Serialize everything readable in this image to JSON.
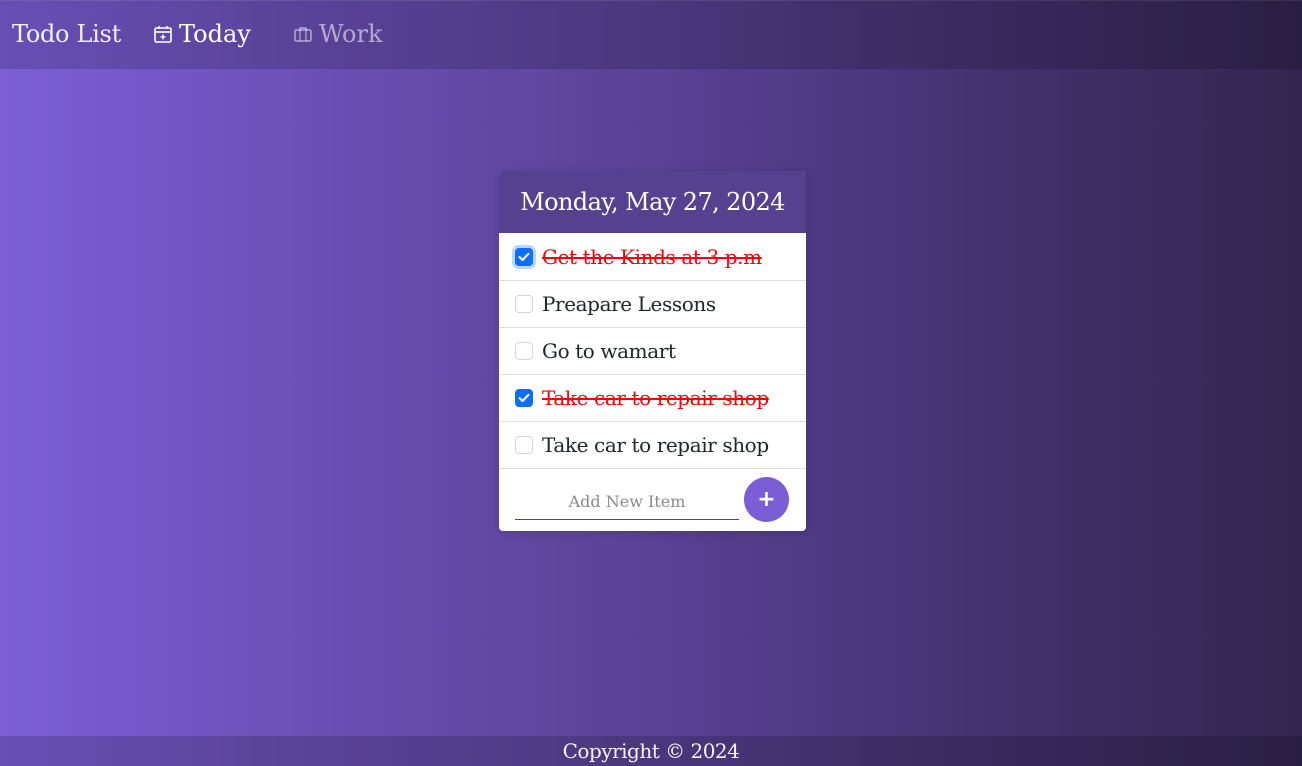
{
  "navbar": {
    "brand": "Todo List",
    "items": [
      {
        "label": "Today",
        "icon": "calendar-plus-icon",
        "active": true
      },
      {
        "label": "Work",
        "icon": "briefcase-icon",
        "active": false
      }
    ]
  },
  "card": {
    "date": "Monday, May 27, 2024",
    "items": [
      {
        "text": "Get the Kinds at 3 p.m",
        "checked": true
      },
      {
        "text": "Preapare Lessons",
        "checked": false
      },
      {
        "text": "Go to wamart",
        "checked": false
      },
      {
        "text": "Take car to repair shop",
        "checked": true
      },
      {
        "text": "Take car to repair shop",
        "checked": false
      }
    ],
    "new_item": {
      "placeholder": "Add New Item",
      "value": "",
      "button_label": "+"
    }
  },
  "footer": {
    "copyright": "Copyright © 2024"
  },
  "colors": {
    "header_bg": "#55418f",
    "accent": "#7b5ed6",
    "checkbox_checked": "#0d6efd",
    "done_text": "#ff0000"
  }
}
